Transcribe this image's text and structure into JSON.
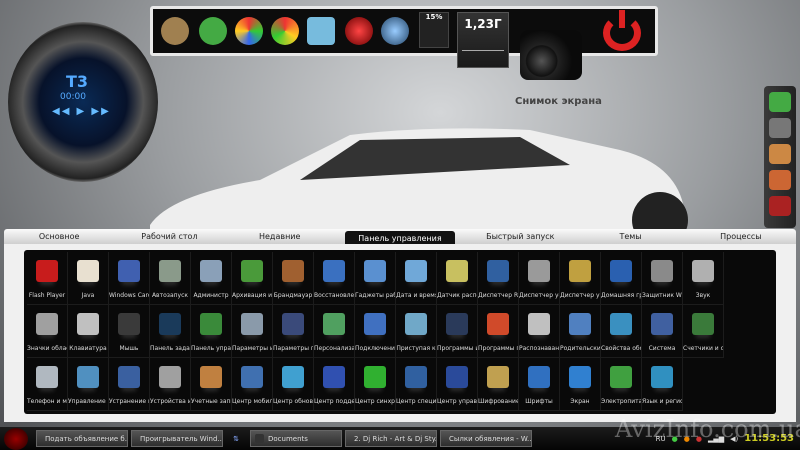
{
  "top_dock": {
    "cpu_percent": "15%",
    "memory": "1,23Г",
    "screenshot_label": "Снимок экрана"
  },
  "player": {
    "title": "T3",
    "time": "00:00",
    "controls": "◀◀ ▶ ▶▶"
  },
  "tabs": [
    "Основное",
    "Рабочий стол",
    "Недавние",
    "Панель управления",
    "Быстрый запуск",
    "Темы",
    "Процессы"
  ],
  "active_tab": "Панель управления",
  "items": [
    {
      "label": "Flash Player",
      "color": "#c81c1c"
    },
    {
      "label": "Java",
      "color": "#e8e0d0"
    },
    {
      "label": "Windows Card",
      "color": "#4060b0"
    },
    {
      "label": "Автозапуск",
      "color": "#8a9a8a"
    },
    {
      "label": "Администр",
      "color": "#8aa0b8"
    },
    {
      "label": "Архивация и",
      "color": "#4a9a3a"
    },
    {
      "label": "Брандмауэр",
      "color": "#a06030"
    },
    {
      "label": "Восстановлен",
      "color": "#3a70c0"
    },
    {
      "label": "Гаджеты раб",
      "color": "#5a90d0"
    },
    {
      "label": "Дата и время",
      "color": "#70a8d8"
    },
    {
      "label": "Датчик распо",
      "color": "#c8c060"
    },
    {
      "label": "Диспетчер Re",
      "color": "#3060a0"
    },
    {
      "label": "Диспетчер ус",
      "color": "#9a9a9a"
    },
    {
      "label": "Диспетчер уч",
      "color": "#c0a040"
    },
    {
      "label": "Домашняя гр",
      "color": "#2a60b0"
    },
    {
      "label": "Защитник Wi",
      "color": "#8a8a8a"
    },
    {
      "label": "Звук",
      "color": "#b0b0b0"
    },
    {
      "label": "Значки облас",
      "color": "#a0a0a0"
    },
    {
      "label": "Клавиатура",
      "color": "#c0c0c0"
    },
    {
      "label": "Мышь",
      "color": "#3a3a3a"
    },
    {
      "label": "Панель задач",
      "color": "#1a3a5a"
    },
    {
      "label": "Панель управ",
      "color": "#3a8a3a"
    },
    {
      "label": "Параметры и",
      "color": "#8a9aaa"
    },
    {
      "label": "Параметры п",
      "color": "#3a4a7a"
    },
    {
      "label": "Персонализа",
      "color": "#50a060"
    },
    {
      "label": "Подключения",
      "color": "#4070c0"
    },
    {
      "label": "Приступая к",
      "color": "#70a8c8"
    },
    {
      "label": "Программы и",
      "color": "#2a3a5a"
    },
    {
      "label": "Программы п",
      "color": "#d04a2a"
    },
    {
      "label": "Распознавани",
      "color": "#c0c0c0"
    },
    {
      "label": "Родительский",
      "color": "#5080c0"
    },
    {
      "label": "Свойства обо",
      "color": "#3a90c0"
    },
    {
      "label": "Система",
      "color": "#4060a0"
    },
    {
      "label": "Счетчики и с",
      "color": "#3a7a3a"
    },
    {
      "label": "Телефон и мо",
      "color": "#b0b8c0"
    },
    {
      "label": "Управление ц",
      "color": "#5090c0"
    },
    {
      "label": "Устранение н",
      "color": "#3a60a0"
    },
    {
      "label": "Устройства и",
      "color": "#a0a0a0"
    },
    {
      "label": "Учетные запи",
      "color": "#c08040"
    },
    {
      "label": "Центр мобиль",
      "color": "#4070b0"
    },
    {
      "label": "Центр обновл",
      "color": "#40a0d0"
    },
    {
      "label": "Центр поддер",
      "color": "#3050b0"
    },
    {
      "label": "Центр синхро",
      "color": "#30b030"
    },
    {
      "label": "Центр специа",
      "color": "#3060a0"
    },
    {
      "label": "Центр управл",
      "color": "#2a4a9a"
    },
    {
      "label": "Шифрование",
      "color": "#c0a050"
    },
    {
      "label": "Шрифты",
      "color": "#3070c0"
    },
    {
      "label": "Экран",
      "color": "#3080d0"
    },
    {
      "label": "Электропитан",
      "color": "#40a040"
    },
    {
      "label": "Язык и регио",
      "color": "#3090c0"
    }
  ],
  "taskbar": {
    "buttons": [
      "Подать объявление б...",
      "Проигрыватель Wind...",
      "Documents",
      "2. Dj Rich - Art & Dj Sty...",
      "Сылки обявления - W..."
    ],
    "language": "RU",
    "clock": "11:53:53"
  },
  "watermark": "AvizInfo.com.ua"
}
